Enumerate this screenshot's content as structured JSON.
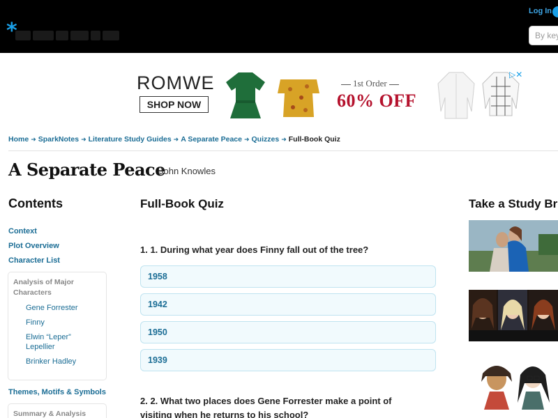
{
  "header": {
    "logo_icon": "asterisk-icon",
    "login_label": "Log In",
    "search_placeholder": "By keyword"
  },
  "ad": {
    "brand": "ROMWE",
    "shop_label": "SHOP NOW",
    "order_text": "1st Order",
    "discount": "60% OFF",
    "close_icon": "adchoices-close-icon"
  },
  "breadcrumb": {
    "items": [
      "Home",
      "SparkNotes",
      "Literature Study Guides",
      "A Separate Peace",
      "Quizzes"
    ],
    "current": "Full-Book Quiz"
  },
  "page": {
    "title": "A Separate Peace",
    "author": "John Knowles"
  },
  "sidebar": {
    "heading": "Contents",
    "links": [
      "Context",
      "Plot Overview",
      "Character List"
    ],
    "group1": {
      "title": "Analysis of Major Characters",
      "items": [
        "Gene Forrester",
        "Finny",
        "Elwin “Leper” Lepellier",
        "Brinker Hadley"
      ]
    },
    "link_themes": "Themes, Motifs & Symbols",
    "group2_title": "Summary & Analysis"
  },
  "main": {
    "heading": "Full-Book Quiz",
    "q1": {
      "text": "1. 1. During what year does Finny fall out of the tree?",
      "answers": [
        "1958",
        "1942",
        "1950",
        "1939"
      ]
    },
    "q2": {
      "text": "2. 2. What two places does Gene Forrester make a point of visiting when he returns to his school?"
    }
  },
  "rail": {
    "heading": "Take a Study Break"
  },
  "colors": {
    "link": "#1b6d95",
    "accent": "#1aa0e8",
    "answer_bg": "#f1fafd",
    "answer_border": "#bfe3f0",
    "ad_red": "#b5122d"
  }
}
